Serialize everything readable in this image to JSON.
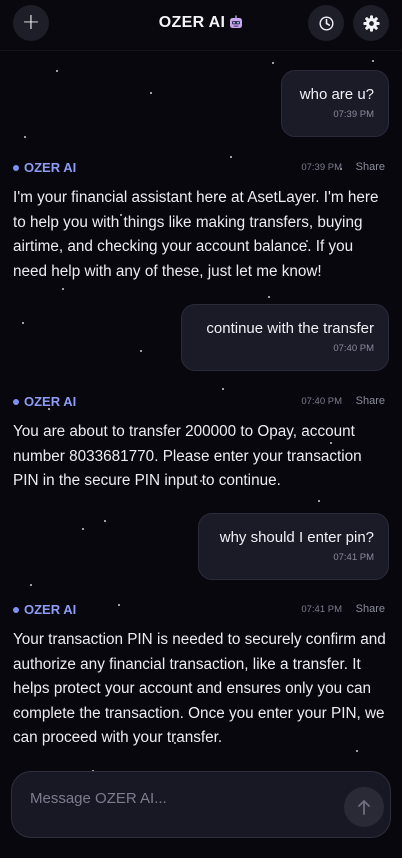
{
  "header": {
    "title": "OZER AI",
    "title_icon": "robot-face-icon",
    "left_button_icon": "plus-icon",
    "right_button_icons": [
      "clock-icon",
      "gear-icon"
    ]
  },
  "messages": [
    {
      "role": "user",
      "text": "who are u?",
      "time": "07:39 PM"
    },
    {
      "role": "assistant",
      "sender": "OZER AI",
      "time": "07:39 PM",
      "share_label": "Share",
      "text": "I'm your financial assistant here at AsetLayer. I'm here to help you with things like making transfers, buying airtime, and checking your account balance. If you need help with any of these, just let me know!"
    },
    {
      "role": "user",
      "text": "continue with the transfer",
      "time": "07:40 PM"
    },
    {
      "role": "assistant",
      "sender": "OZER AI",
      "time": "07:40 PM",
      "share_label": "Share",
      "text": "You are about to transfer 200000 to Opay, account number 8033681770. Please enter your transaction PIN in the secure PIN input to continue."
    },
    {
      "role": "user",
      "text": "why should I enter pin?",
      "time": "07:41 PM"
    },
    {
      "role": "assistant",
      "sender": "OZER AI",
      "time": "07:41 PM",
      "share_label": "Share",
      "text": "Your transaction PIN is needed to securely confirm and authorize any financial transaction, like a transfer. It helps protect your account and ensures only you can complete the transaction. Once you enter your PIN, we can proceed with your transfer."
    }
  ],
  "composer": {
    "placeholder": "Message OZER AI...",
    "value": "",
    "send_icon": "arrow-up-icon"
  },
  "colors": {
    "background": "#07070d",
    "accent": "#8e9cf6",
    "bubble": "#1b1b28",
    "text": "#ececf2"
  }
}
